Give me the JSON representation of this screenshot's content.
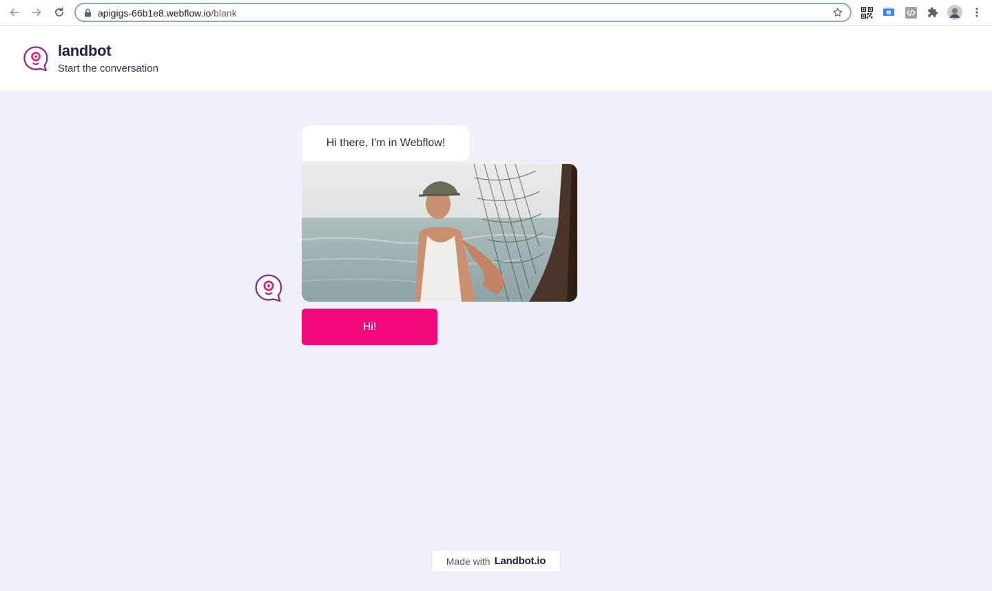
{
  "browser": {
    "url_host": "apigigs-66b1e8.webflow.io",
    "url_path": "/blank",
    "icons": [
      "back-arrow-icon",
      "forward-arrow-icon",
      "reload-icon",
      "lock-icon",
      "star-icon",
      "qr-code-icon",
      "extension-icon",
      "code-icon",
      "puzzle-icon",
      "profile-avatar",
      "kebab-menu-icon"
    ]
  },
  "header": {
    "brand": "landbot",
    "subtitle": "Start the conversation"
  },
  "chat": {
    "message": "Hi there, I'm in Webflow!",
    "button_label": "Hi!"
  },
  "footer": {
    "made_with": "Made with",
    "brand": "Landbot.io"
  },
  "colors": {
    "accent": "#f3087b",
    "background": "#f0f0f9",
    "brand_text": "#252542",
    "logo_purple": "#8a2a8e"
  }
}
